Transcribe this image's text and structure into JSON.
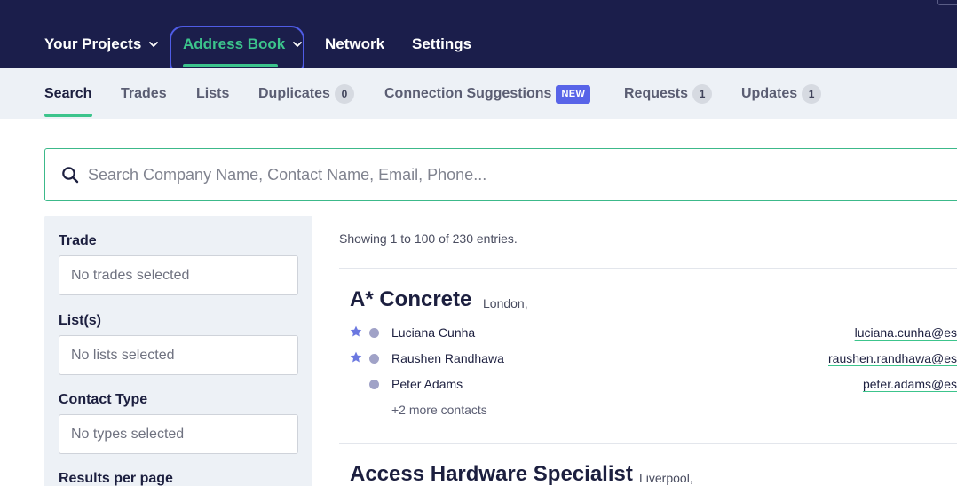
{
  "nav": {
    "items": [
      {
        "label": "Your Projects",
        "has_dropdown": true,
        "active": false
      },
      {
        "label": "Address Book",
        "has_dropdown": true,
        "active": true
      },
      {
        "label": "Network",
        "has_dropdown": false,
        "active": false
      },
      {
        "label": "Settings",
        "has_dropdown": false,
        "active": false
      }
    ]
  },
  "subnav": {
    "tabs": [
      {
        "label": "Search",
        "active": true
      },
      {
        "label": "Trades"
      },
      {
        "label": "Lists"
      },
      {
        "label": "Duplicates",
        "count": "0"
      },
      {
        "label": "Connection Suggestions",
        "badge": "NEW"
      },
      {
        "label": "Requests",
        "count": "1"
      },
      {
        "label": "Updates",
        "count": "1"
      }
    ]
  },
  "search": {
    "placeholder": "Search Company Name, Contact Name, Email, Phone...",
    "icon": "search-icon"
  },
  "filters": {
    "trade_label": "Trade",
    "trade_placeholder": "No trades selected",
    "lists_label": "List(s)",
    "lists_placeholder": "No lists selected",
    "contact_type_label": "Contact Type",
    "contact_type_placeholder": "No types selected",
    "results_per_page_label": "Results per page"
  },
  "results": {
    "showing": "Showing 1 to 100 of 230 entries.",
    "companies": [
      {
        "name": "A* Concrete",
        "city": "London,",
        "contacts": [
          {
            "name": "Luciana Cunha",
            "email": "luciana.cunha@es",
            "starred": true
          },
          {
            "name": "Raushen Randhawa",
            "email": "raushen.randhawa@es",
            "starred": true
          },
          {
            "name": "Peter Adams",
            "email": "peter.adams@es",
            "starred": false
          }
        ],
        "more": "+2 more contacts"
      },
      {
        "name": "Access Hardware Specialist",
        "city": "Liverpool,"
      }
    ]
  },
  "colors": {
    "nav_bg": "#1b1e4b",
    "accent_green": "#3cc48c",
    "focus_ring": "#4f5ce6",
    "subnav_bg": "#edf1f6",
    "new_badge": "#5864e8",
    "star": "#6b78e0",
    "dot": "#a0a2c7"
  }
}
